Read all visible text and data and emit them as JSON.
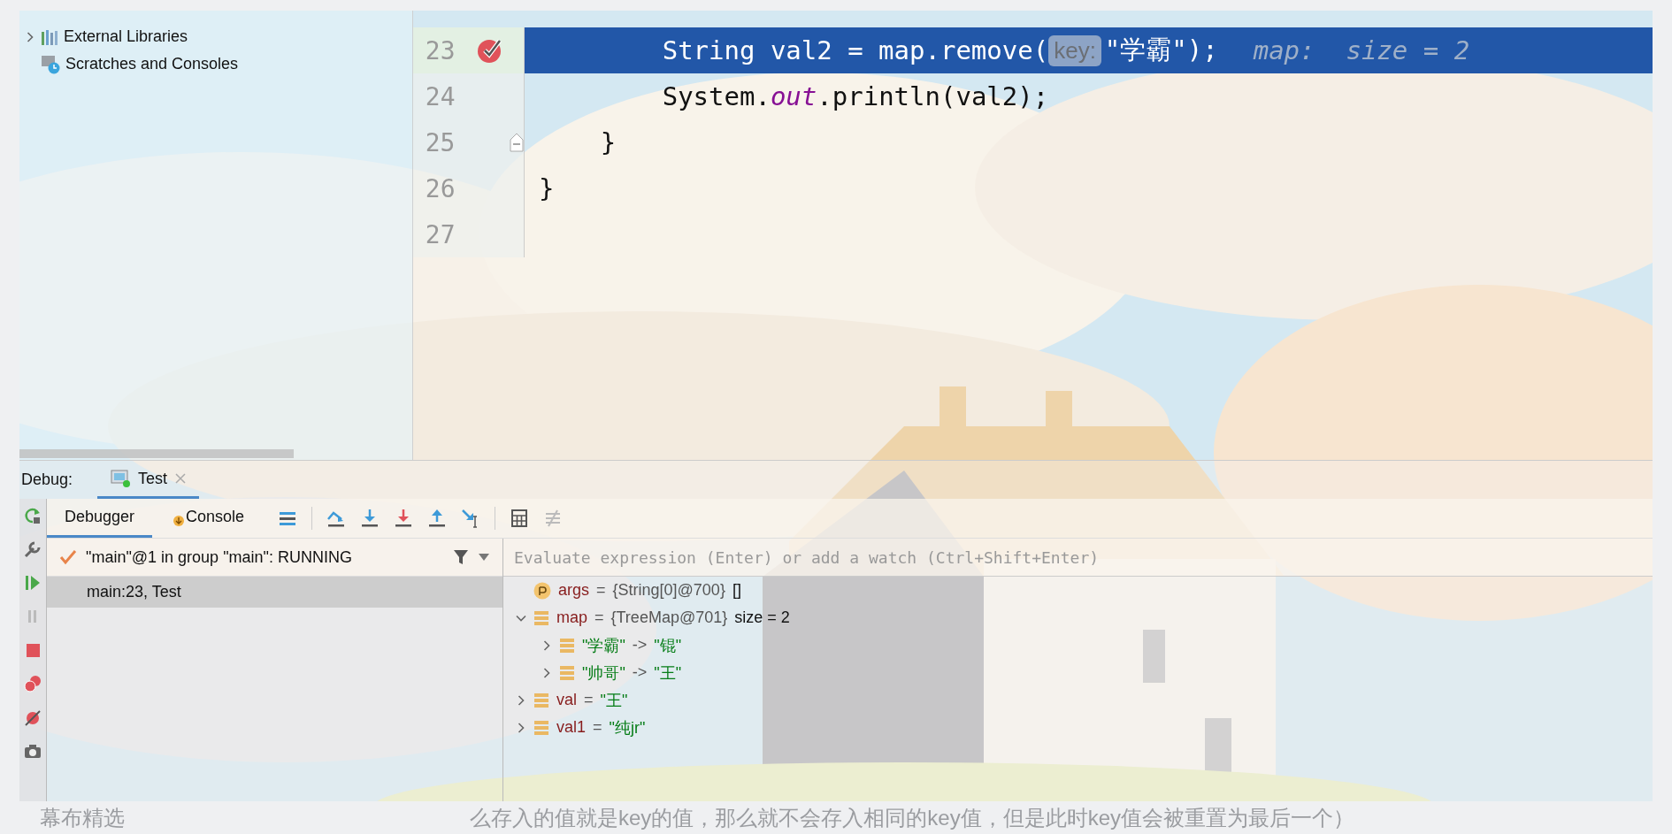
{
  "project_tree": [
    {
      "label": "External Libraries",
      "kind": "libraries",
      "expanded": false
    },
    {
      "label": "Scratches and Consoles",
      "kind": "scratches"
    }
  ],
  "editor": {
    "lines": [
      {
        "number": "23",
        "breakpoint": true,
        "current": true,
        "fold": false,
        "segments": [
          {
            "kind": "code",
            "text": "        String val2 = map.remove("
          },
          {
            "kind": "hint",
            "text": "key:"
          },
          {
            "kind": "code",
            "text": "\"学霸\");"
          },
          {
            "kind": "inline",
            "text": "map:  size = 2"
          }
        ]
      },
      {
        "number": "24",
        "breakpoint": false,
        "current": false,
        "fold": false,
        "segments": [
          {
            "kind": "code",
            "text": "        System."
          },
          {
            "kind": "static",
            "text": "out"
          },
          {
            "kind": "code",
            "text": ".println(val2);"
          }
        ]
      },
      {
        "number": "25",
        "breakpoint": false,
        "current": false,
        "fold": true,
        "segments": [
          {
            "kind": "code",
            "text": "    }"
          }
        ]
      },
      {
        "number": "26",
        "breakpoint": false,
        "current": false,
        "fold": false,
        "segments": [
          {
            "kind": "code",
            "text": "}"
          }
        ]
      },
      {
        "number": "27",
        "breakpoint": false,
        "current": false,
        "fold": false
      }
    ]
  },
  "debug": {
    "title": "Debug:",
    "tabs": [
      {
        "label": "Test",
        "selected": true
      }
    ],
    "subtabs": [
      {
        "label": "Debugger",
        "selected": true
      },
      {
        "label": "Console",
        "selected": false
      }
    ],
    "thread": "\"main\"@1 in group \"main\": RUNNING",
    "frames": [
      {
        "label": "main:23, Test",
        "selected": true
      }
    ],
    "watch": {
      "placeholder": "Evaluate expression (Enter) or add a watch (Ctrl+Shift+Enter)"
    },
    "variables": [
      {
        "kind": "parameter",
        "name": "args",
        "separator": "=",
        "value": "{String[0]@700}",
        "extra": "[]"
      },
      {
        "kind": "object",
        "name": "map",
        "separator": "=",
        "value": "{TreeMap@701}",
        "extra": "size = 2",
        "expanded": true,
        "children": [
          {
            "kind": "entry",
            "name": "\"学霸\"",
            "separator": "->",
            "value": "\"锟\"",
            "expanded": false
          },
          {
            "kind": "entry",
            "name": "\"帅哥\"",
            "separator": "->",
            "value": "\"王\"",
            "expanded": false
          }
        ]
      },
      {
        "kind": "string",
        "name": "val",
        "separator": "=",
        "value": "\"王\"",
        "expanded": false
      },
      {
        "kind": "string",
        "name": "val1",
        "separator": "=",
        "value": "\"纯jr\"",
        "expanded": false
      }
    ]
  },
  "page_behind": {
    "side_label": "幕布精选",
    "text": "么存入的值就是key的值，那么就不会存入相同的key值，但是此时key值会被重置为最后一个）"
  }
}
